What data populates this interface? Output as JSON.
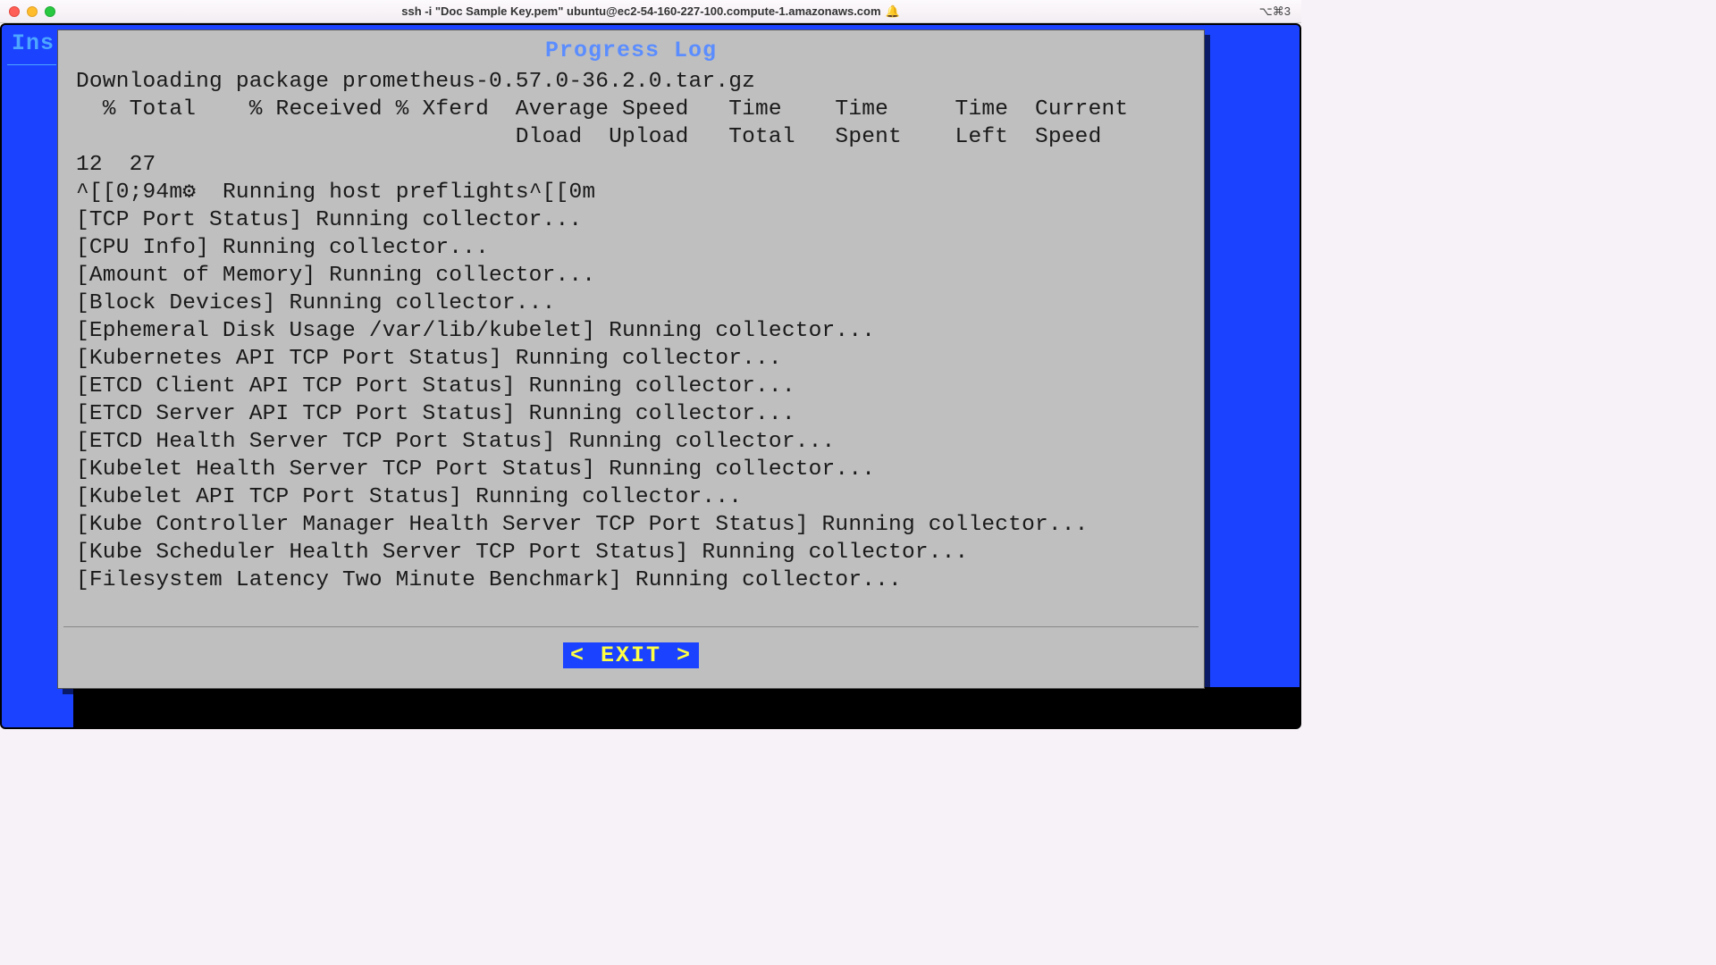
{
  "window": {
    "title": "ssh -i \"Doc Sample Key.pem\" ubuntu@ec2-54-160-227-100.compute-1.amazonaws.com",
    "right_indicator": "⌥⌘3"
  },
  "background": {
    "partial_label": "Ins"
  },
  "dialog": {
    "title": "Progress Log",
    "exit_label": "< EXIT >",
    "log": {
      "line1": "Downloading package prometheus-0.57.0-36.2.0.tar.gz",
      "line2": "  % Total    % Received % Xferd  Average Speed   Time    Time     Time  Current",
      "line3": "                                 Dload  Upload   Total   Spent    Left  Speed",
      "line4": "12  27",
      "line5a": "^[[0;94m",
      "line5b": "  Running host preflights^[[0m",
      "line6": "[TCP Port Status] Running collector...",
      "line7": "[CPU Info] Running collector...",
      "line8": "[Amount of Memory] Running collector...",
      "line9": "[Block Devices] Running collector...",
      "line10": "[Ephemeral Disk Usage /var/lib/kubelet] Running collector...",
      "line11": "[Kubernetes API TCP Port Status] Running collector...",
      "line12": "[ETCD Client API TCP Port Status] Running collector...",
      "line13": "[ETCD Server API TCP Port Status] Running collector...",
      "line14": "[ETCD Health Server TCP Port Status] Running collector...",
      "line15": "[Kubelet Health Server TCP Port Status] Running collector...",
      "line16": "[Kubelet API TCP Port Status] Running collector...",
      "line17": "[Kube Controller Manager Health Server TCP Port Status] Running collector...",
      "line18": "[Kube Scheduler Health Server TCP Port Status] Running collector...",
      "line19": "[Filesystem Latency Two Minute Benchmark] Running collector..."
    }
  }
}
